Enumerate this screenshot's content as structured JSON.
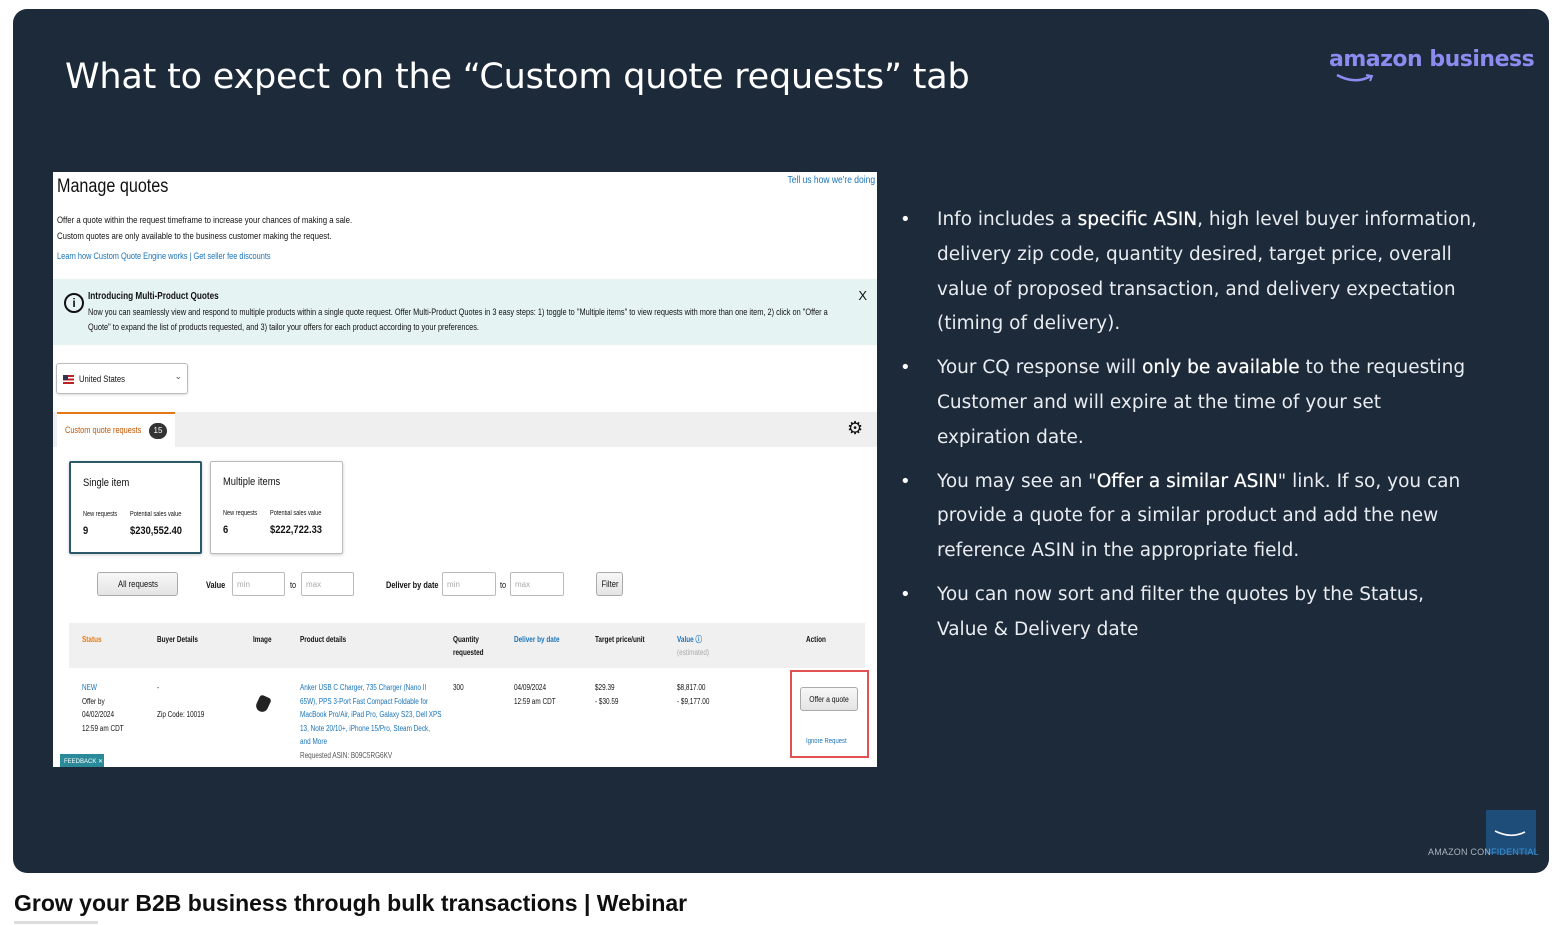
{
  "slide": {
    "title": "What to expect on the “Custom quote requests” tab",
    "logo_text": "amazon business",
    "confidential_a": "AMAZON CON",
    "confidential_b": "FIDENTIAL"
  },
  "screenshot": {
    "title": "Manage quotes",
    "tell_us": "Tell us how we're doing",
    "desc_line1": "Offer a quote within the request timeframe to increase your chances of making a sale.",
    "desc_line2": "Custom quotes are only available to the business customer making the request.",
    "links": "Learn how Custom Quote Engine works | Get seller fee discounts",
    "banner": {
      "icon": "i",
      "title": "Introducing Multi-Product Quotes",
      "text_line1": "Now you can seamlessly view and respond to multiple products within a single quote request. Offer Multi-Product Quotes in 3 easy steps: 1) toggle to \"Multiple items\" to view requests with more than one item, 2) click on \"Offer a",
      "text_line2": "Quote\" to expand the list of products requested, and 3) tailor your offers for each product according to your preferences.",
      "close": "X"
    },
    "country": "United States",
    "tab": {
      "label": "Custom quote requests",
      "count": "15"
    },
    "cards": {
      "single": {
        "title": "Single item",
        "new_label": "New requests",
        "value_label": "Potential sales value",
        "new_count": "9",
        "value": "$230,552.40"
      },
      "multiple": {
        "title": "Multiple items",
        "new_label": "New requests",
        "value_label": "Potential sales value",
        "new_count": "6",
        "value": "$222,722.33"
      }
    },
    "filters": {
      "status": "All requests",
      "value_label": "Value",
      "min": "min",
      "to": "to",
      "max": "max",
      "deliver_label": "Deliver by date",
      "filter_btn": "Filter"
    },
    "table": {
      "headers": {
        "status": "Status",
        "buyer": "Buyer Details",
        "image": "Image",
        "product": "Product details",
        "qty1": "Quantity",
        "qty2": "requested",
        "deliver": "Deliver by date",
        "target": "Target price/unit",
        "value": "Value ⓘ",
        "value_sub": "(estimated)",
        "action": "Action"
      },
      "row": {
        "status": "NEW",
        "offer_by": "Offer by",
        "offer_date": "04/02/2024",
        "offer_time": "12:59 am CDT",
        "buyer_dash": "-",
        "zip": "Zip Code: 10019",
        "product_l1": "Anker USB C Charger, 735 Charger (Nano II",
        "product_l2": "65W), PPS 3-Port Fast Compact Foldable for",
        "product_l3": "MacBook Pro/Air, iPad Pro, Galaxy S23, Dell XPS",
        "product_l4": "13, Note 20/10+, iPhone 15/Pro, Steam Deck,",
        "product_l5": "and More",
        "asin": "Requested ASIN: B09C5RG6KV",
        "qty": "300",
        "deliver_date": "04/09/2024",
        "deliver_time": "12:59 am CDT",
        "target_l1": "$29.39",
        "target_l2": "- $30.59",
        "value_l1": "$8,817.00",
        "value_l2": "- $9,177.00",
        "offer_btn": "Offer a quote",
        "ignore": "Ignore Request"
      }
    },
    "feedback": "FEEDBACK ✕"
  },
  "bullets": [
    {
      "pre": "Info includes a ",
      "bold": "specific ASIN",
      "post": ", high level buyer information, delivery zip code, quantity desired, target price, overall value of proposed transaction, and delivery expectation (timing of delivery)."
    },
    {
      "pre": "Your CQ response will ",
      "bold": "only be available",
      "post": " to the requesting Customer and will expire at the time of your set expiration date."
    },
    {
      "pre": "You may see an \"",
      "bold": "Offer a similar ASIN",
      "post": "\" link. If so, you can provide a quote for a similar product and add the new reference ASIN in the appropriate field."
    },
    {
      "pre": "You can now sort and filter the quotes by the Status, Value & Delivery date",
      "bold": "",
      "post": ""
    }
  ],
  "video_title": "Grow your B2B business through bulk transactions | Webinar",
  "colors": {
    "slide_bg": "#1d2a3a",
    "logo": "#8a8cf0",
    "highlight_box": "#e05252",
    "tab_accent": "#e47911"
  }
}
